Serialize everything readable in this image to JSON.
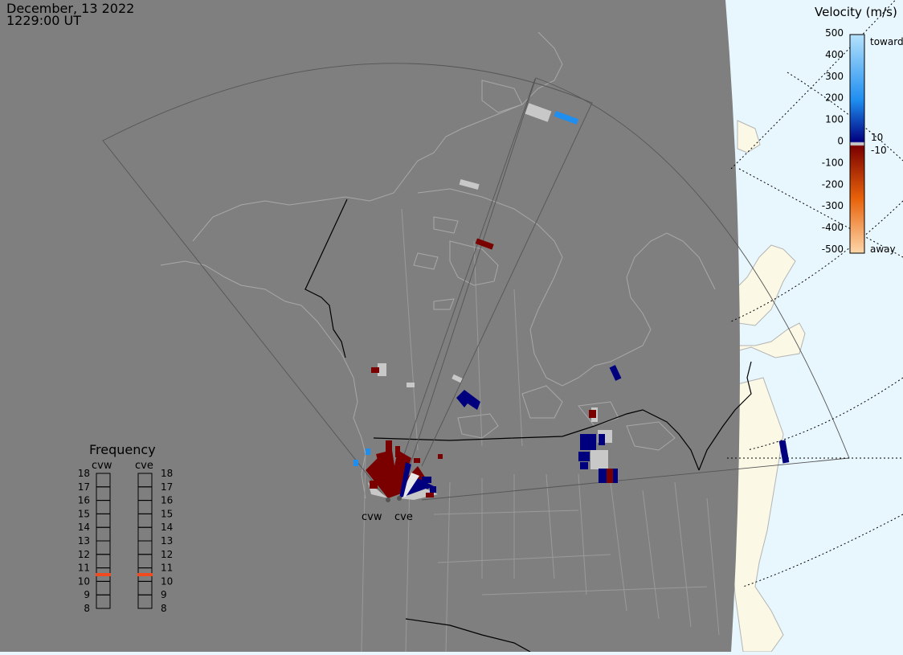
{
  "header": {
    "date": "December, 13 2022",
    "time": "1229:00 UT"
  },
  "radars": [
    {
      "id": "cvw",
      "label": "cvw"
    },
    {
      "id": "cve",
      "label": "cve"
    }
  ],
  "legend": {
    "title": "Velocity (m/s)",
    "ticks": [
      "500",
      "400",
      "300",
      "200",
      "100",
      "0",
      "-100",
      "-200",
      "-300",
      "-400",
      "-500"
    ],
    "tick_values": [
      500,
      400,
      300,
      200,
      100,
      0,
      -100,
      -200,
      -300,
      -400,
      -500
    ],
    "small_labels": [
      "10",
      "-10"
    ],
    "toward_label": "toward",
    "away_label": "away",
    "colors": {
      "toward_light": "#b5e2fc",
      "toward_mid": "#1e8ef0",
      "toward_dark": "#00007f",
      "ground_scatter": "#c8c8c8",
      "away_dark": "#7a0000",
      "away_mid": "#e8620a",
      "away_light": "#fdd7aa"
    }
  },
  "frequency": {
    "title": "Frequency",
    "columns": [
      {
        "id": "cvw",
        "label": "cvw",
        "selected": 11
      },
      {
        "id": "cve",
        "label": "cve",
        "selected": 11
      }
    ],
    "levels": [
      "18",
      "17",
      "16",
      "15",
      "14",
      "13",
      "12",
      "11",
      "10",
      "9",
      "8"
    ],
    "marker_color": "#f04a1e"
  },
  "map": {
    "night_color": "#7f7f7f",
    "ocean_color": "#e8f6fd",
    "land_day_color": "#fbf8e6",
    "coast_color": "#b4b4b4",
    "border_color": "#000000"
  }
}
